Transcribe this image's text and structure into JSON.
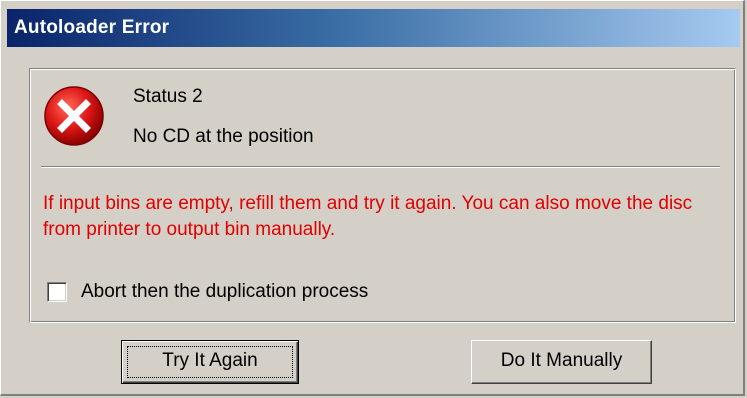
{
  "window": {
    "title": "Autoloader Error"
  },
  "status": {
    "code_text": "Status 2",
    "message": "No CD at the position"
  },
  "hint": {
    "text": "If input bins are empty, refill them and try it again. You can also move the disc from printer to output bin manually.",
    "color": "#e00000"
  },
  "abort_option": {
    "label": "Abort then the duplication process",
    "checked": false
  },
  "buttons": {
    "try_again": "Try It Again",
    "manual": "Do It Manually"
  },
  "icons": {
    "error": "error-x-icon"
  }
}
